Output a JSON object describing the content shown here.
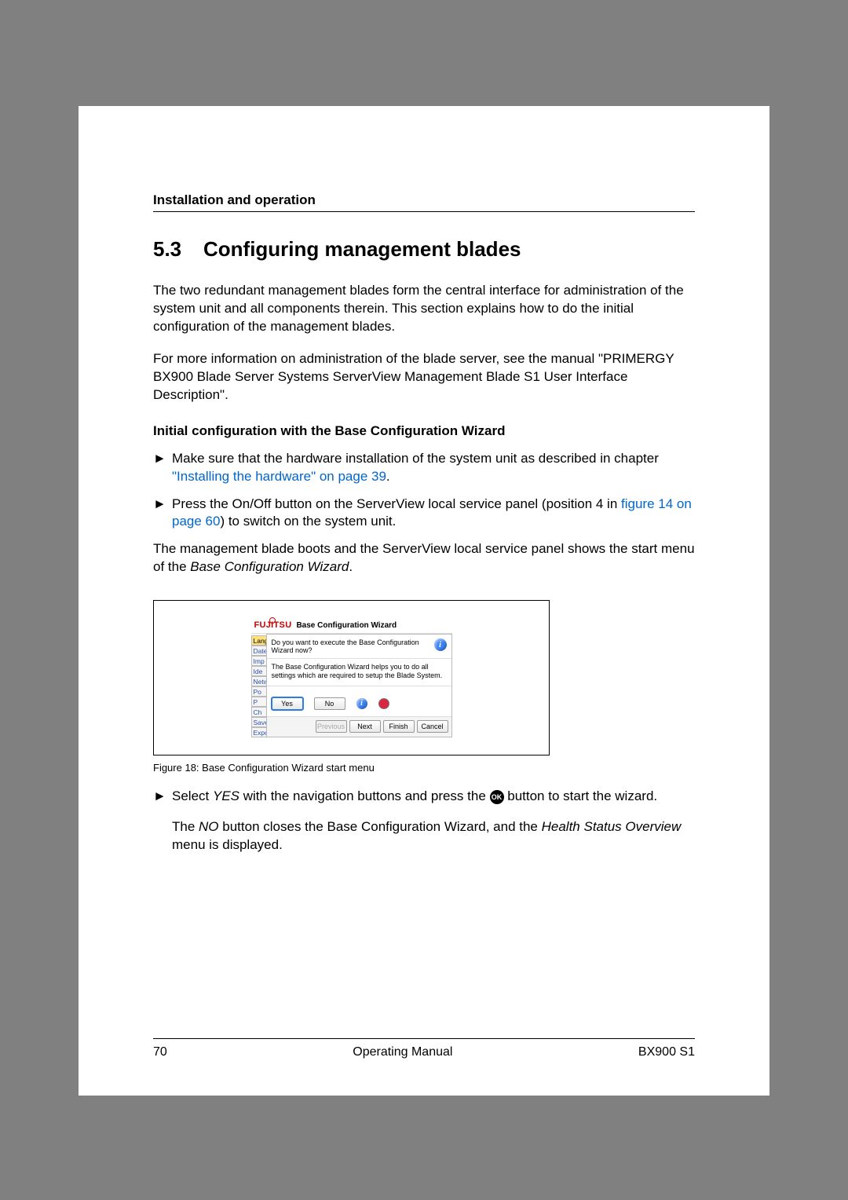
{
  "header": {
    "section": "Installation and operation"
  },
  "heading": {
    "number": "5.3",
    "title": "Configuring management blades"
  },
  "paragraphs": {
    "intro": "The two redundant management blades form the central interface for administration of the system unit and all components therein. This section explains how to do the initial configuration of the management blades.",
    "moreinfo": "For more information on administration of the blade server, see the manual \"PRIMERGY BX900 Blade Server Systems ServerView Management Blade S1 User Interface Description\"."
  },
  "subheading": "Initial configuration with the Base Configuration Wizard",
  "bullets": {
    "b1_pre": "Make sure that the hardware installation of the system unit as described in chapter ",
    "b1_link": "\"Installing the hardware\" on page 39",
    "b1_post": ".",
    "b2_pre": "Press the On/Off button on the ServerView local service panel (position 4 in ",
    "b2_link": "figure 14 on page 60",
    "b2_post": ") to switch on the system unit."
  },
  "midpara_pre": "The management blade boots and the ServerView local service panel shows the start menu of the ",
  "midpara_em": "Base Configuration Wizard",
  "midpara_post": ".",
  "figure": {
    "logo": "FUJITSU",
    "title": "Base Configuration Wizard",
    "question": "Do you want to execute the Base Configuration Wizard now?",
    "description": "The Base Configuration Wizard helps you to do all settings which are required to setup the Blade System.",
    "tabs": [
      "Lang",
      "Date",
      "Imp",
      "Ide",
      "Netw",
      "Po",
      "P",
      "Ch",
      "Save",
      "Export"
    ],
    "yes": "Yes",
    "no": "No",
    "previous": "Previous",
    "next": "Next",
    "finish": "Finish",
    "cancel": "Cancel",
    "caption": "Figure 18: Base Configuration Wizard start menu"
  },
  "after": {
    "sel_pre": "Select ",
    "sel_yes": "YES",
    "sel_mid": " with the navigation buttons and press the ",
    "sel_post": " button to start the wizard.",
    "ok_label": "OK",
    "no_pre": "The ",
    "no_em1": "NO",
    "no_mid": " button closes the Base Configuration Wizard, and the ",
    "no_em2": "Health Status Overview",
    "no_post": " menu is displayed."
  },
  "footer": {
    "page": "70",
    "center": "Operating Manual",
    "right": "BX900 S1"
  }
}
